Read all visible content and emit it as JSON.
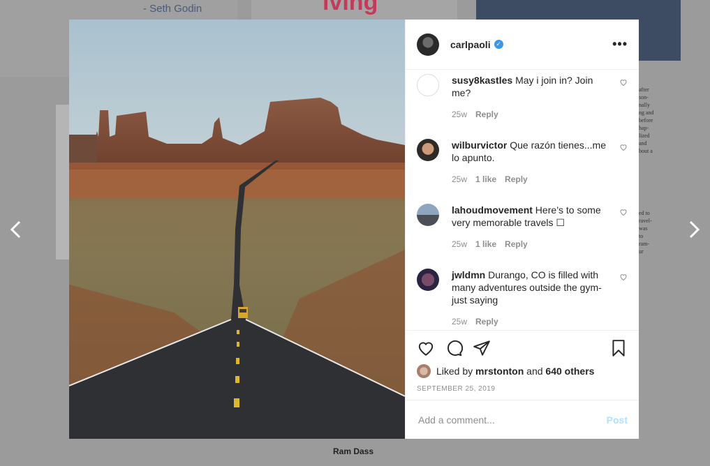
{
  "background": {
    "quote_author": "- Seth Godin",
    "heading_fragment": "iving",
    "caption_name": "Ram Dass",
    "side_text_1": "after\nson-\nnally\nng and\nbefore\nhap-\nlized\nand\nbout a",
    "side_text_2": "ed to\nravel-\nwas\nto\nram-\nur"
  },
  "post": {
    "username": "carlpaoli",
    "verified_icon": "verified-badge-icon",
    "more_icon": "more-options-icon"
  },
  "comments": [
    {
      "user": "susy8kastles",
      "text": "May i join in? Join me?",
      "age": "25w",
      "likes": "",
      "reply": "Reply"
    },
    {
      "user": "wilburvictor",
      "text": "Que razón tienes...me lo apunto.",
      "age": "25w",
      "likes": "1 like",
      "reply": "Reply"
    },
    {
      "user": "lahoudmovement",
      "text": "Here’s to some very memorable travels ☐",
      "age": "25w",
      "likes": "1 like",
      "reply": "Reply"
    },
    {
      "user": "jwldmn",
      "text": "Durango, CO is filled with many adventures outside the gym- just saying",
      "age": "25w",
      "likes": "",
      "reply": "Reply"
    }
  ],
  "actions": {
    "liked_by_prefix": "Liked by",
    "liked_by_user": "mrstonton",
    "and_text": "and",
    "others": "640 others",
    "date": "SEPTEMBER 25, 2019"
  },
  "add_comment": {
    "placeholder": "Add a comment...",
    "post_label": "Post"
  },
  "colors": {
    "accent": "#3897f0",
    "post_disabled": "#b2dffc",
    "muted": "#8e8e8e"
  }
}
